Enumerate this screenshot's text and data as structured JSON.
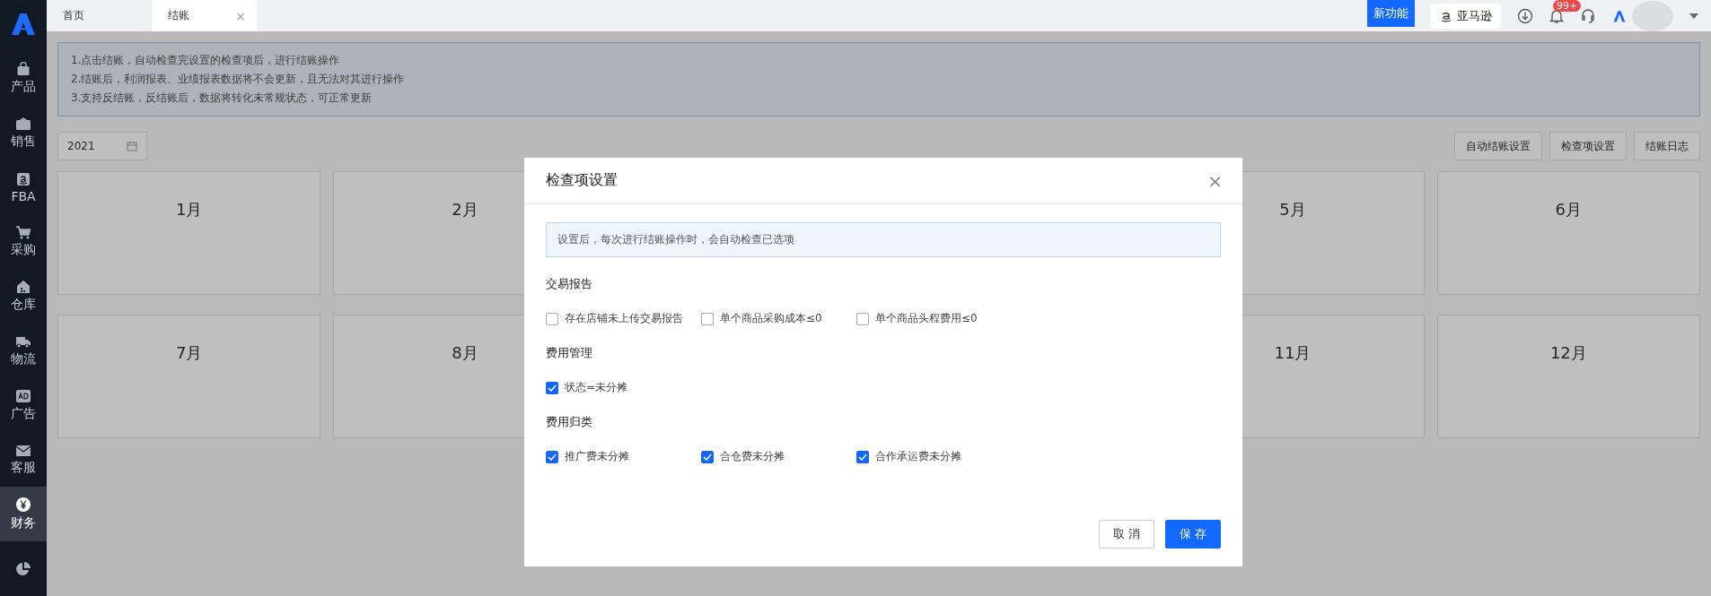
{
  "sidebar": {
    "items": [
      {
        "kind": "bag",
        "label": "产品",
        "selected": false
      },
      {
        "kind": "sel",
        "label": "销售",
        "selected": false
      },
      {
        "kind": "amazon",
        "label": "FBA",
        "selected": false
      },
      {
        "kind": "cart",
        "label": "采购",
        "selected": false
      },
      {
        "kind": "warehouse",
        "label": "仓库",
        "selected": false
      },
      {
        "kind": "truck",
        "label": "物流",
        "selected": false
      },
      {
        "kind": "ad",
        "label": "广告",
        "selected": false
      },
      {
        "kind": "mail",
        "label": "客服",
        "selected": false
      },
      {
        "kind": "yen",
        "label": "财务",
        "selected": true
      },
      {
        "kind": "pie",
        "selected": false
      }
    ]
  },
  "tabs": [
    {
      "label": "首页",
      "selected": false
    },
    {
      "label": "结账",
      "selected": true,
      "close": "×"
    }
  ],
  "header": {
    "new_feature": "新功能",
    "marketplace": "亚马逊",
    "notification_count": "99+"
  },
  "notice": [
    "1.点击结账，自动检查完设置的检查项后，进行结账操作",
    "2.结账后，利润报表、业绩报表数据将不会更新，且无法对其进行操作",
    "3.支持反结账，反结账后，数据将转化未常规状态，可正常更新"
  ],
  "year_picker": {
    "value": "2021"
  },
  "toolbar_buttons": [
    "自动结账设置",
    "检查项设置",
    "结账日志"
  ],
  "months": [
    "1月",
    "2月",
    "5月",
    "6月",
    "7月",
    "8月",
    "11月",
    "12月"
  ],
  "dialog": {
    "title": "检查项设置",
    "close": "×",
    "info": "设置后，每次进行结账操作时，会自动检查已选项",
    "sections": [
      {
        "title": "交易报告",
        "options": [
          {
            "label": "存在店铺未上传交易报告",
            "checked": false
          },
          {
            "label": "单个商品采购成本≤0",
            "checked": false
          },
          {
            "label": "单个商品头程费用≤0",
            "checked": false
          }
        ]
      },
      {
        "title": "费用管理",
        "options": [
          {
            "label": "状态=未分摊",
            "checked": true
          }
        ]
      },
      {
        "title": "费用归类",
        "options": [
          {
            "label": "推广费未分摊",
            "checked": true
          },
          {
            "label": "合仓费未分摊",
            "checked": true
          },
          {
            "label": "合作承运费未分摊",
            "checked": true
          }
        ]
      }
    ],
    "buttons": [
      {
        "label": "取 消",
        "kind": "secondary"
      },
      {
        "label": "保 存",
        "kind": "primary"
      }
    ]
  }
}
